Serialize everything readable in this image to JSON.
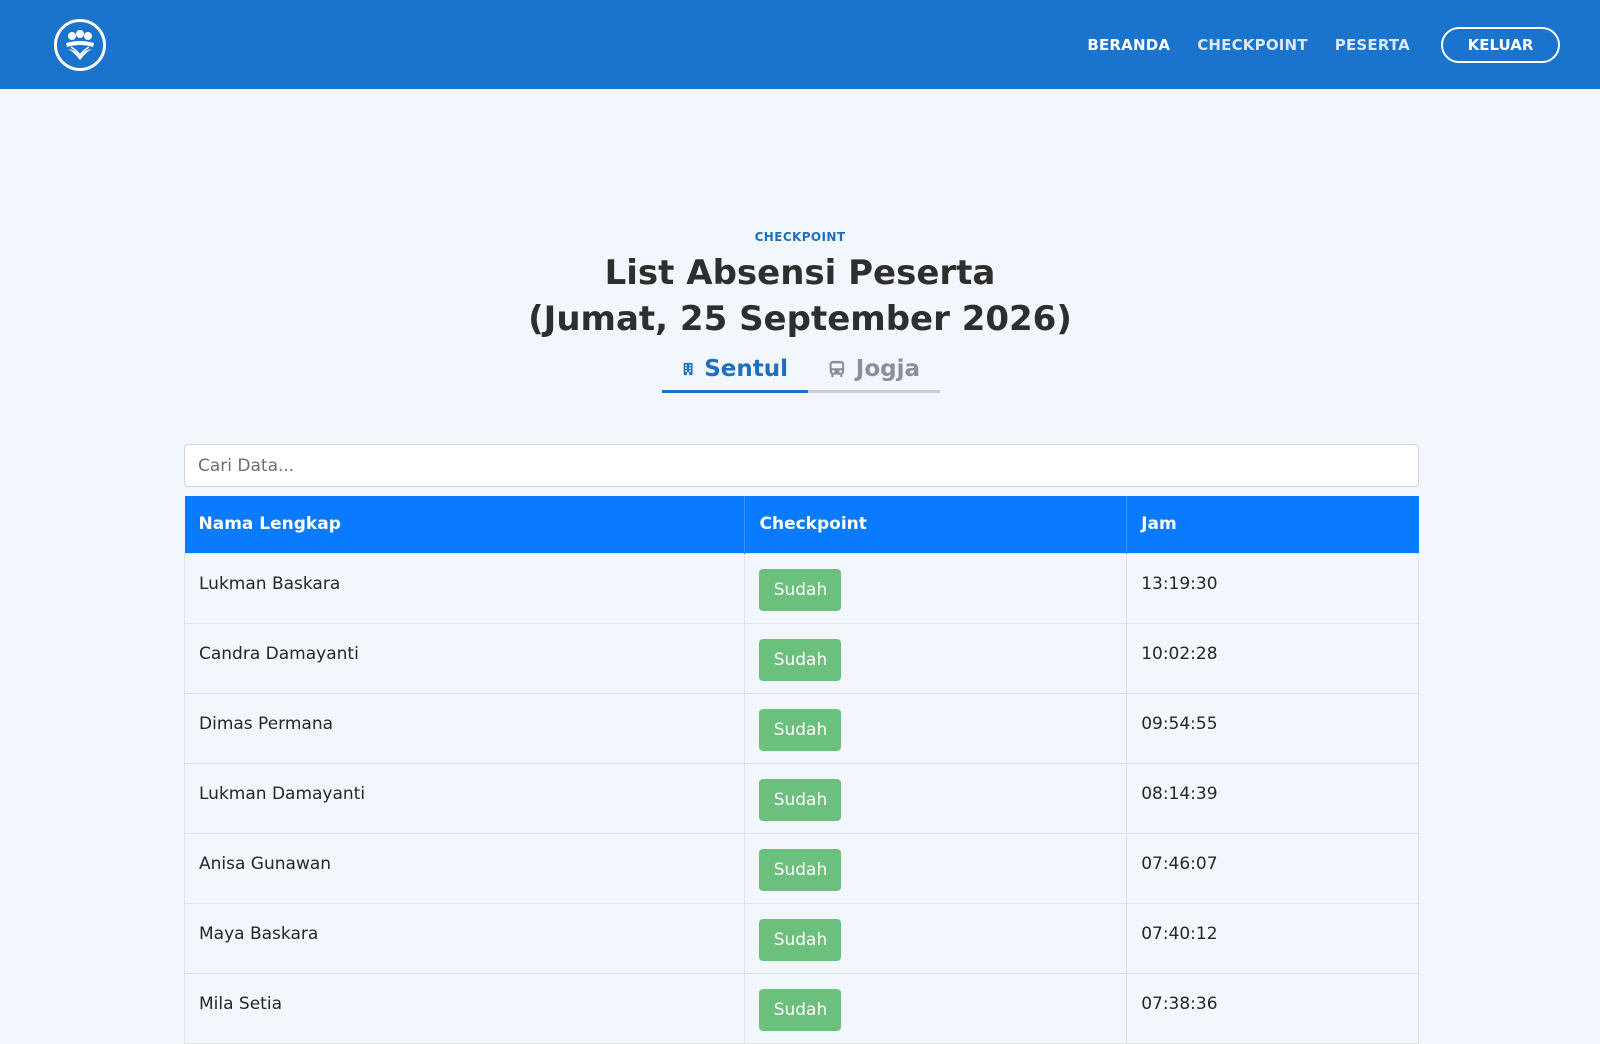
{
  "nav": {
    "links": [
      {
        "label": "BERANDA",
        "active": true
      },
      {
        "label": "CHECKPOINT",
        "active": false
      },
      {
        "label": "PESERTA",
        "active": false
      }
    ],
    "logout_label": "KELUAR"
  },
  "header": {
    "eyebrow": "CHECKPOINT",
    "title_line1": "List Absensi Peserta",
    "title_line2": "(Jumat, 25 September 2026)"
  },
  "tabs": [
    {
      "label": "Sentul",
      "icon": "building-icon",
      "active": true
    },
    {
      "label": "Jogja",
      "icon": "bus-icon",
      "active": false
    }
  ],
  "search": {
    "placeholder": "Cari Data..."
  },
  "table": {
    "columns": [
      "Nama Lengkap",
      "Checkpoint",
      "Jam"
    ],
    "rows": [
      {
        "name": "Lukman Baskara",
        "status": "Sudah",
        "time": "13:19:30"
      },
      {
        "name": "Candra Damayanti",
        "status": "Sudah",
        "time": "10:02:28"
      },
      {
        "name": "Dimas Permana",
        "status": "Sudah",
        "time": "09:54:55"
      },
      {
        "name": "Lukman Damayanti",
        "status": "Sudah",
        "time": "08:14:39"
      },
      {
        "name": "Anisa Gunawan",
        "status": "Sudah",
        "time": "07:46:07"
      },
      {
        "name": "Maya Baskara",
        "status": "Sudah",
        "time": "07:40:12"
      },
      {
        "name": "Mila Setia",
        "status": "Sudah",
        "time": "07:38:36"
      }
    ]
  },
  "colors": {
    "navbar": "#1a73cc",
    "table_header": "#0a7bff",
    "badge_success": "#6cc07e",
    "accent": "#1f6fc0",
    "background": "#f2f6fd"
  }
}
